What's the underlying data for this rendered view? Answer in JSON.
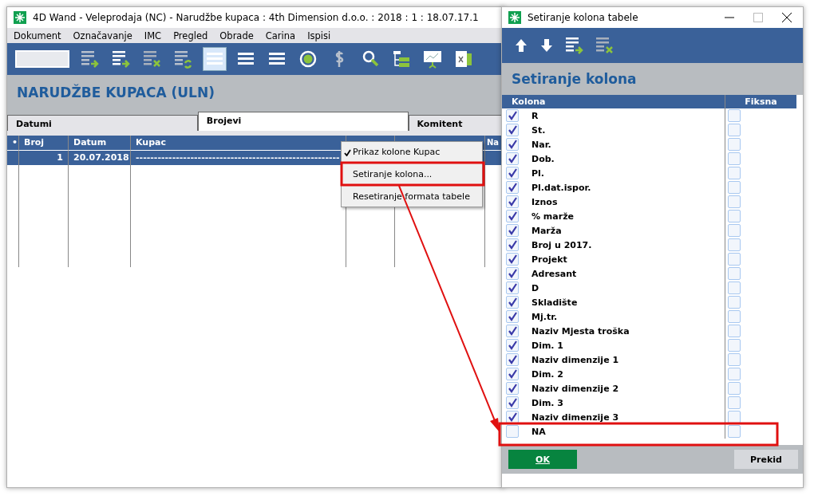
{
  "main_window": {
    "title": "4D Wand - Veleprodaja (NC) - Narudžbe kupaca : 4th Dimension d.o.o. : 2018 : 1 : 18.07.17.1",
    "menu": [
      "Dokument",
      "Označavanje",
      "IMC",
      "Pregled",
      "Obrade",
      "Carina",
      "Ispisi"
    ],
    "toolbar": [
      {
        "kind": "add-row",
        "selected": false
      },
      {
        "kind": "add-row-white",
        "selected": false
      },
      {
        "kind": "delete-row",
        "selected": false
      },
      {
        "kind": "refresh-row",
        "selected": false
      },
      {
        "kind": "list",
        "selected": true
      },
      {
        "kind": "list",
        "selected": false
      },
      {
        "kind": "list",
        "selected": false
      },
      {
        "kind": "radio",
        "selected": false
      },
      {
        "kind": "dollar",
        "selected": false
      },
      {
        "kind": "search",
        "selected": false
      },
      {
        "kind": "tree",
        "selected": false
      },
      {
        "kind": "chart",
        "selected": false
      },
      {
        "kind": "excel",
        "selected": false
      }
    ],
    "page_title": "NARUDŽBE KUPACA (ULN)",
    "tabs": [
      {
        "label": "Datumi",
        "selected": false
      },
      {
        "label": "Brojevi",
        "selected": true
      },
      {
        "label": "Komitent",
        "selected": false
      }
    ],
    "table": {
      "columns": [
        "•",
        "Broj",
        "Datum",
        "Kupac",
        "Na"
      ],
      "rows": [
        {
          "cells": [
            "",
            "1",
            "20.07.2018",
            "--------------------------------------------------------"
          ],
          "selected": true
        }
      ]
    }
  },
  "context_menu": {
    "items": [
      {
        "label": "Prikaz kolone Kupac",
        "checked": true
      },
      {
        "label": "Setiranje kolona...",
        "checked": false
      },
      {
        "label": "Resetiranje formata tabele",
        "checked": false
      }
    ]
  },
  "dialog": {
    "title": "Setiranje kolona tabele",
    "heading": "Setiranje kolona",
    "columns": [
      "Kolona",
      "Fiksna"
    ],
    "rows": [
      {
        "name": "R",
        "checked": true,
        "fixed": false
      },
      {
        "name": "St.",
        "checked": true,
        "fixed": false
      },
      {
        "name": "Nar.",
        "checked": true,
        "fixed": false
      },
      {
        "name": "Dob.",
        "checked": true,
        "fixed": false
      },
      {
        "name": "Pl.",
        "checked": true,
        "fixed": false
      },
      {
        "name": "Pl.dat.ispor.",
        "checked": true,
        "fixed": false
      },
      {
        "name": "Iznos",
        "checked": true,
        "fixed": false
      },
      {
        "name": "% marže",
        "checked": true,
        "fixed": false
      },
      {
        "name": "Marža",
        "checked": true,
        "fixed": false
      },
      {
        "name": "Broj u 2017.",
        "checked": true,
        "fixed": false
      },
      {
        "name": "Projekt",
        "checked": true,
        "fixed": false
      },
      {
        "name": "Adresant",
        "checked": true,
        "fixed": false
      },
      {
        "name": "D",
        "checked": true,
        "fixed": false
      },
      {
        "name": "Skladište",
        "checked": true,
        "fixed": false
      },
      {
        "name": "Mj.tr.",
        "checked": true,
        "fixed": false
      },
      {
        "name": "Naziv Mjesta troška",
        "checked": true,
        "fixed": false
      },
      {
        "name": "Dim. 1",
        "checked": true,
        "fixed": false
      },
      {
        "name": "Naziv dimenzije 1",
        "checked": true,
        "fixed": false
      },
      {
        "name": "Dim. 2",
        "checked": true,
        "fixed": false
      },
      {
        "name": "Naziv dimenzije 2",
        "checked": true,
        "fixed": false
      },
      {
        "name": "Dim. 3",
        "checked": true,
        "fixed": false
      },
      {
        "name": "Naziv dimenzije 3",
        "checked": true,
        "fixed": false
      },
      {
        "name": "NA",
        "checked": false,
        "fixed": false
      }
    ],
    "buttons": [
      {
        "label": "OK",
        "kind": "primary"
      },
      {
        "label": "Prekid",
        "kind": "secondary"
      }
    ]
  }
}
